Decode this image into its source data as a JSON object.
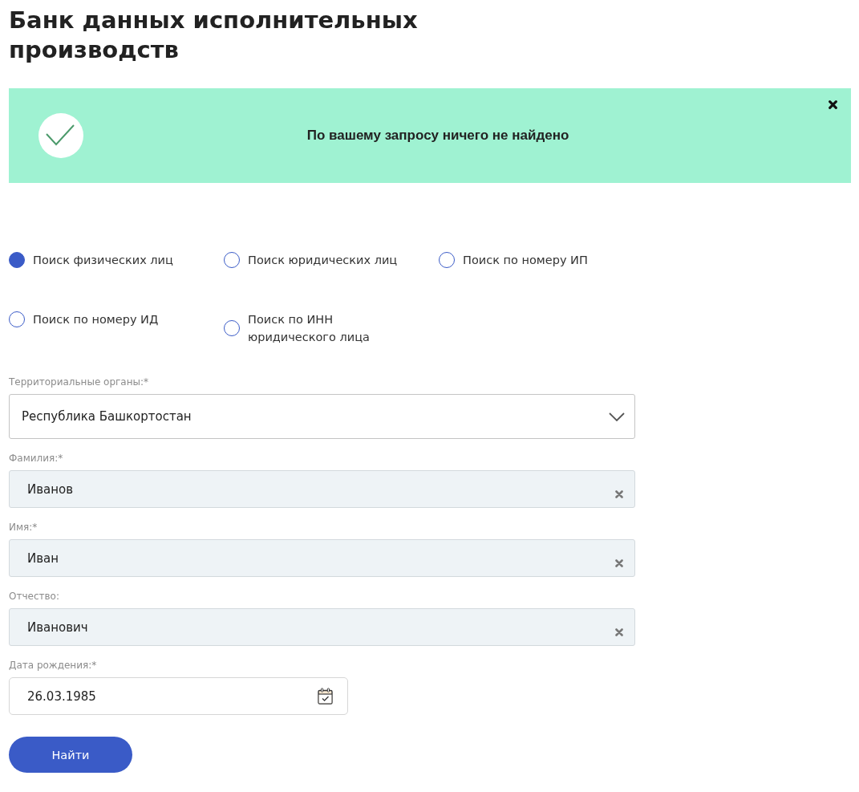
{
  "page": {
    "title": "Банк данных исполнительных производств"
  },
  "alert": {
    "kind": "success",
    "message": "По вашему запросу ничего не найдено",
    "closable": true
  },
  "search_modes": [
    {
      "label": "Поиск физических лиц",
      "selected": true
    },
    {
      "label": "Поиск юридических лиц",
      "selected": false
    },
    {
      "label": "Поиск по номеру ИП",
      "selected": false
    },
    {
      "label": "Поиск по номеру ИД",
      "selected": false
    },
    {
      "label": "Поиск по ИНН юридического лица",
      "selected": false
    }
  ],
  "fields": [
    {
      "kind": "select",
      "label": "Территориальные органы:*",
      "value": "Республика Башкортостан"
    },
    {
      "kind": "text",
      "label": "Фамилия:*",
      "value": "Иванов",
      "clearable": true
    },
    {
      "kind": "text",
      "label": "Имя:*",
      "value": "Иван",
      "clearable": true
    },
    {
      "kind": "text",
      "label": "Отчество:",
      "value": "Иванович",
      "clearable": true
    },
    {
      "kind": "date",
      "label": "Дата рождения:*",
      "value": "26.03.1985"
    }
  ],
  "submit": {
    "label": "Найти"
  }
}
